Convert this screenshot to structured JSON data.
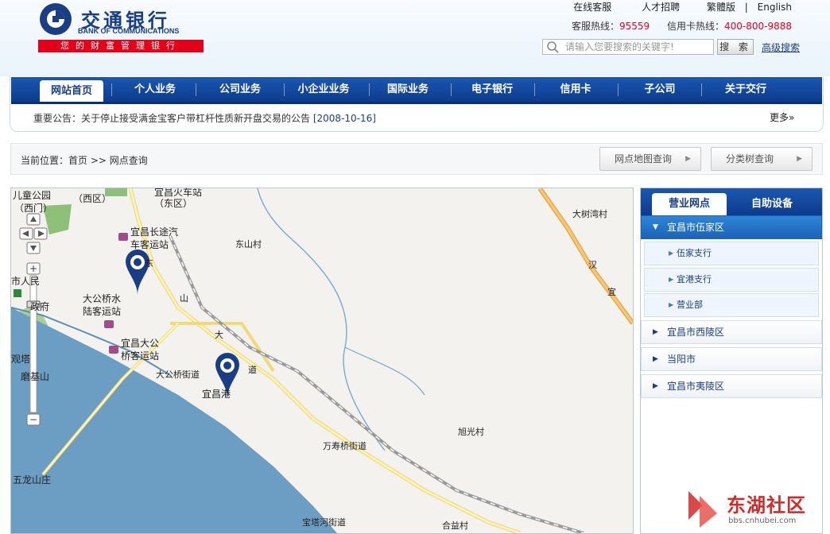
{
  "brand": {
    "name_cn": "交通银行",
    "name_en": "BANK OF COMMUNICATIONS",
    "slogan": "您的财富管理银行",
    "color": "#1a3e86",
    "accent": "#e3001b"
  },
  "toplinks": [
    "在线客服",
    "人才招聘",
    "繁體版",
    "English"
  ],
  "hotline": {
    "service_label": "客服热线：",
    "service_num": "95559",
    "card_label": "信用卡热线：",
    "card_num": "400-800-9888"
  },
  "search": {
    "placeholder": "请输入您要搜索的关键字!",
    "button": "搜 索",
    "advanced": "高级搜索"
  },
  "nav": [
    "网站首页",
    "个人业务",
    "公司业务",
    "小企业业务",
    "国际业务",
    "电子银行",
    "信用卡",
    "子公司",
    "关于交行"
  ],
  "notice": {
    "text": "重要公告：关于停止接受满金宝客户带杠杆性质新开盘交易的公告",
    "date": "[2008-10-16]",
    "more": "更多»"
  },
  "breadcrumb": "当前位置：首页 >> 网点查询",
  "buttons": {
    "map": "网点地图查询",
    "tree": "分类树查询"
  },
  "map_labels": [
    "儿童公园",
    "（西门）",
    "（西区）",
    "宜昌火车站",
    "（东区）",
    "大树湾村",
    "宜昌长途汽",
    "车客运站",
    "东山村",
    "市人民",
    "政府",
    "大公桥水",
    "陆客运站",
    "宜昌大公",
    "桥客运站",
    "大公桥街道",
    "宜昌港",
    "观塔",
    "磨基山",
    "旭光村",
    "万寿桥街道",
    "五龙山庄",
    "宝塔河街道",
    "合益村",
    "东",
    "山",
    "大",
    "道",
    "汉",
    "宜"
  ],
  "side": {
    "tabs": [
      "营业网点",
      "自助设备"
    ],
    "regions": [
      "宜昌市伍家区",
      "宜昌市西陵区",
      "当阳市",
      "宜昌市夷陵区"
    ],
    "branches": [
      "伍家支行",
      "宜港支行",
      "营业部"
    ]
  },
  "watermark": {
    "text": "东湖社区",
    "sub": "bbs.cnhubei.com"
  }
}
